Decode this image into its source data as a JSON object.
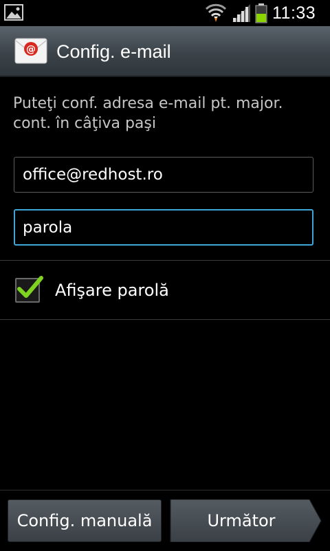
{
  "status_bar": {
    "time": "11:33",
    "icons": [
      "gallery-notification-icon",
      "wifi-icon",
      "signal-icon",
      "battery-icon"
    ]
  },
  "header": {
    "title": "Config. e-mail",
    "icon": "email-app-icon"
  },
  "main": {
    "description": "Puteţi conf. adresa e-mail pt. major. cont. în câţiva paşi",
    "email_value": "office@redhost.ro",
    "password_value": "parola",
    "show_password_label": "Afişare parolă",
    "show_password_checked": true
  },
  "footer": {
    "manual_setup_label": "Config. manuală",
    "next_label": "Următor"
  },
  "colors": {
    "accent_focus": "#3ea7d8",
    "check_green": "#7ed321",
    "battery_green": "#8bd400"
  }
}
